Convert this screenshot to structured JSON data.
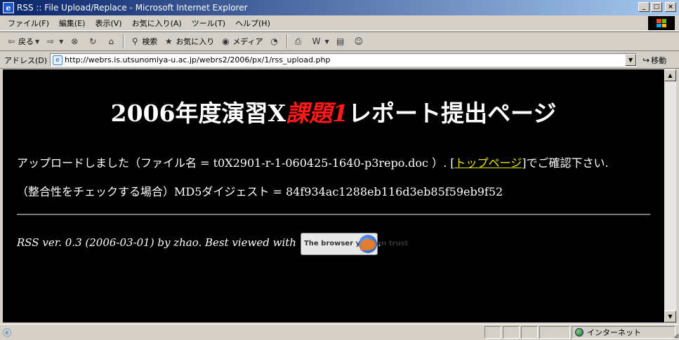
{
  "window": {
    "title": "RSS :: File Upload/Replace - Microsoft Internet Explorer",
    "app_icon_glyph": "e",
    "minimize": "_",
    "maximize": "□",
    "close": "×"
  },
  "menu": {
    "items": [
      "ファイル(F)",
      "編集(E)",
      "表示(V)",
      "お気に入り(A)",
      "ツール(T)",
      "ヘルプ(H)"
    ]
  },
  "toolbar": {
    "back_label": "戻る",
    "search_label": "検索",
    "favorites_label": "お気に入り",
    "media_label": "メディア"
  },
  "address": {
    "label": "アドレス(D)",
    "url": "http://webrs.is.utsunomiya-u.ac.jp/webrs2/2006/px/1/rss_upload.php",
    "go_label": "移動"
  },
  "page": {
    "title_prefix": "2006年度演習X",
    "title_accent": "課題1",
    "title_suffix": "レポート提出ページ",
    "upload_msg_prefix": "アップロードしました（ファイル名 = t0X2901-r-1-060425-1640-p3repo.doc ）.  [",
    "top_link": "トップページ",
    "upload_msg_suffix": "]でご確認下さい.",
    "md5_line": "（整合性をチェックする場合）MD5ダイジェスト = 84f934ac1288eb116d3eb85f59eb9f52",
    "footer_text": "RSS ver. 0.3 (2006-03-01) by zhao. Best viewed with",
    "footer_period": ".",
    "badge_text": "The browser you can trust"
  },
  "status": {
    "zone_label": "インターネット"
  },
  "colors": {
    "page_bg": "#000000",
    "accent_red": "#ff1a1a",
    "link_yellow": "#e6e600"
  }
}
